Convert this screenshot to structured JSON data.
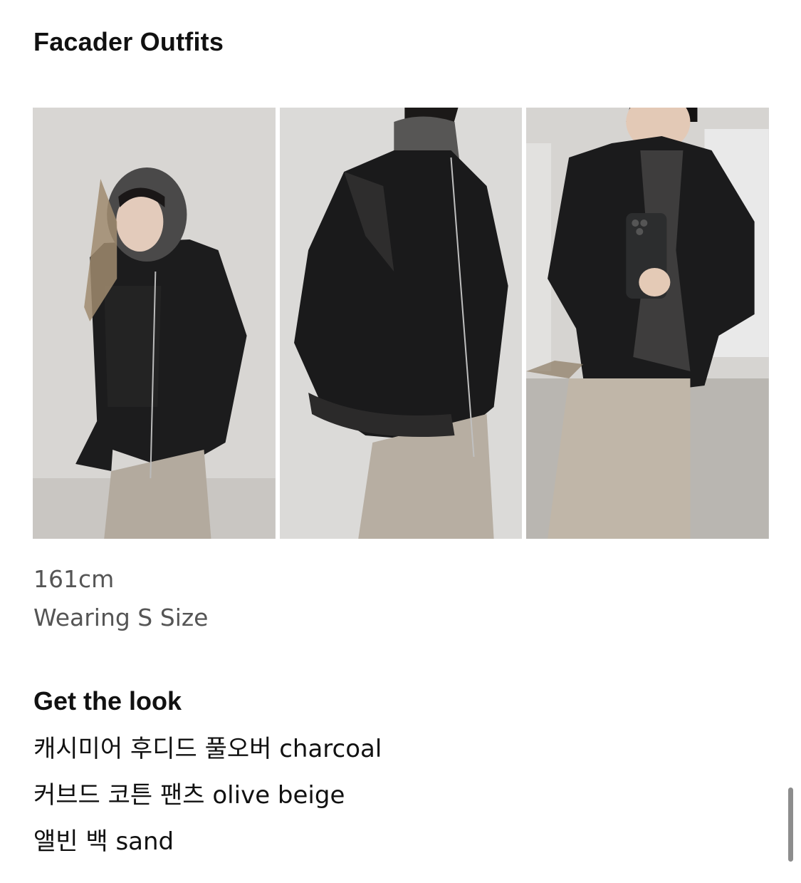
{
  "header": {
    "title": "Facader Outfits"
  },
  "photos": [
    {
      "name": "outfit-photo-front-hooded"
    },
    {
      "name": "outfit-photo-side-closeup"
    },
    {
      "name": "outfit-photo-mirror-selfie"
    }
  ],
  "model_info": {
    "height": "161cm",
    "size_note": "Wearing S Size"
  },
  "get_the_look": {
    "title": "Get the look",
    "items": [
      "캐시미어 후디드 풀오버 charcoal",
      "커브드 코튼 팬츠 olive beige",
      "앨빈 백 sand"
    ]
  },
  "colors": {
    "background": "#ffffff",
    "text": "#111111",
    "secondary_text": "#555555",
    "scrollbar": "#8d8d8d"
  }
}
